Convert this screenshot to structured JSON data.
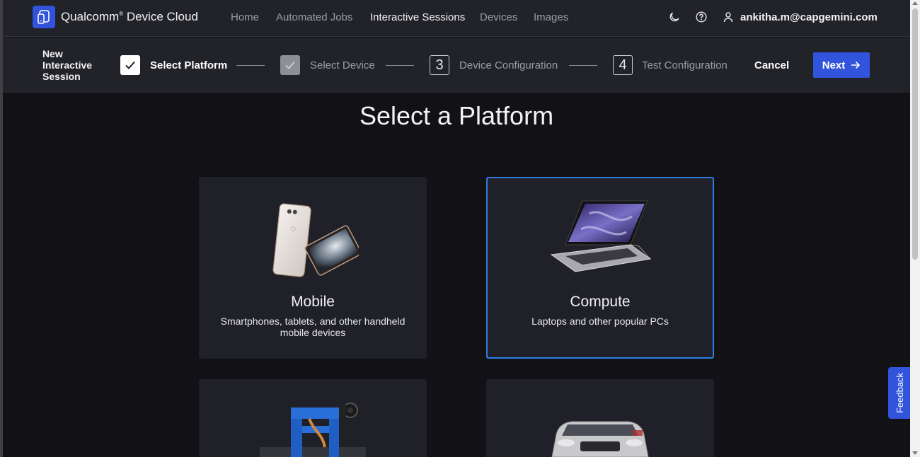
{
  "nav": {
    "brand": "Qualcomm",
    "brand_mark": "®",
    "brand_suffix": " Device Cloud",
    "links": [
      {
        "label": "Home",
        "active": false
      },
      {
        "label": "Automated Jobs",
        "active": false
      },
      {
        "label": "Interactive Sessions",
        "active": true
      },
      {
        "label": "Devices",
        "active": false
      },
      {
        "label": "Images",
        "active": false
      }
    ],
    "icons": [
      "moon-icon",
      "help-icon",
      "user-icon"
    ],
    "user_email": "ankitha.m@capgemini.com"
  },
  "wizard": {
    "title": "New Interactive Session",
    "steps": [
      {
        "label": "Select Platform",
        "state": "current-done"
      },
      {
        "label": "Select Device",
        "state": "done"
      },
      {
        "number": "3",
        "label": "Device Configuration",
        "state": "pending"
      },
      {
        "number": "4",
        "label": "Test Configuration",
        "state": "pending"
      }
    ],
    "cancel_label": "Cancel",
    "next_label": "Next"
  },
  "main": {
    "heading": "Select a Platform",
    "cards": [
      {
        "title": "Mobile",
        "description": "Smartphones, tablets, and other handheld mobile devices",
        "image": "phone-tablet-image",
        "selected": false
      },
      {
        "title": "Compute",
        "description": "Laptops and other popular PCs",
        "image": "laptop-image",
        "selected": true
      },
      {
        "title": "",
        "description": "",
        "image": "iot-board-image",
        "selected": false
      },
      {
        "title": "",
        "description": "",
        "image": "car-image",
        "selected": false
      }
    ]
  },
  "feedback_label": "Feedback",
  "colors": {
    "accent": "#3253dc",
    "selected_border": "#2f7de1",
    "background": "#121216",
    "bar": "#222329",
    "card": "#1f2028"
  }
}
